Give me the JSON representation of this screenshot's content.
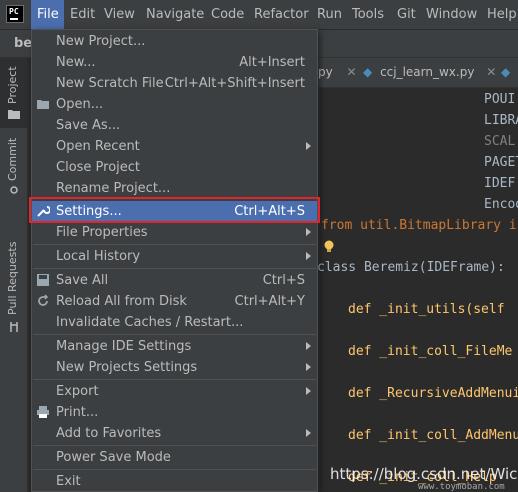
{
  "app": {
    "logo_text": "PC",
    "project_name": "bei"
  },
  "menubar": {
    "items": [
      {
        "label": "File",
        "active": true
      },
      {
        "label": "Edit"
      },
      {
        "label": "View"
      },
      {
        "label": "Navigate"
      },
      {
        "label": "Code"
      },
      {
        "label": "Refactor"
      },
      {
        "label": "Run"
      },
      {
        "label": "Tools"
      },
      {
        "label": "Git"
      },
      {
        "label": "Window"
      },
      {
        "label": "Help"
      }
    ]
  },
  "toolstrip": {
    "project": "Project",
    "commit": "Commit",
    "pull_requests": "Pull Requests"
  },
  "editor": {
    "tabs": [
      {
        "label": "py"
      },
      {
        "label": "ccj_learn_wx.py"
      }
    ],
    "right_words": [
      "POUI",
      "LIBRA",
      "SCAL",
      "PAGET",
      "IDEF",
      "Encod"
    ],
    "line_import": "from util.BitmapLibrary i",
    "line_class": "class Beremiz(IDEFrame):",
    "line_def1": "def _init_utils(self",
    "line_def2": "def _init_coll_FileMe",
    "line_def3": "def _RecursiveAddMenui",
    "line_def4": "def _init_coll_AddMenu",
    "line_def5": "def _init_coll_Help"
  },
  "file_menu": {
    "items": [
      {
        "label": "New Project...",
        "shortcut": ""
      },
      {
        "label": "New...",
        "shortcut": "Alt+Insert"
      },
      {
        "label": "New Scratch File",
        "shortcut": "Ctrl+Alt+Shift+Insert"
      },
      {
        "label": "Open...",
        "shortcut": "",
        "icon": "folder-icon"
      },
      {
        "label": "Save As...",
        "shortcut": ""
      },
      {
        "label": "Open Recent",
        "submenu": true
      },
      {
        "label": "Close Project",
        "shortcut": ""
      },
      {
        "label": "Rename Project...",
        "shortcut": ""
      },
      {
        "label": "Settings...",
        "shortcut": "Ctrl+Alt+S",
        "icon": "wrench-icon",
        "highlighted": true
      },
      {
        "label": "File Properties",
        "submenu": true
      },
      {
        "label": "Local History",
        "submenu": true
      },
      {
        "label": "Save All",
        "shortcut": "Ctrl+S",
        "icon": "save-icon"
      },
      {
        "label": "Reload All from Disk",
        "shortcut": "Ctrl+Alt+Y",
        "icon": "reload-icon"
      },
      {
        "label": "Invalidate Caches / Restart...",
        "shortcut": ""
      },
      {
        "label": "Manage IDE Settings",
        "submenu": true
      },
      {
        "label": "New Projects Settings",
        "submenu": true
      },
      {
        "label": "Export",
        "submenu": true
      },
      {
        "label": "Print...",
        "shortcut": "",
        "icon": "print-icon"
      },
      {
        "label": "Add to Favorites",
        "submenu": true
      },
      {
        "label": "Power Save Mode",
        "shortcut": ""
      },
      {
        "label": "Exit",
        "shortcut": ""
      }
    ]
  },
  "watermark": {
    "text": "https://blog.csdn.net/Wicoi",
    "small": "www.toymoban.com"
  },
  "colors": {
    "accent": "#4b6eaf",
    "highlight_border": "#e0262c",
    "menu_bg": "#3c3f41",
    "editor_bg": "#2b2b2b"
  }
}
